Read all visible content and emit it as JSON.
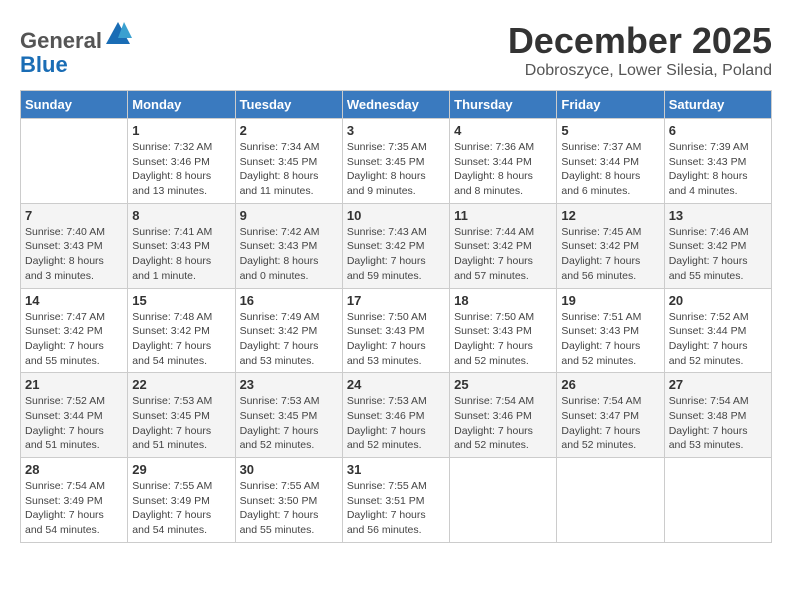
{
  "logo": {
    "general": "General",
    "blue": "Blue"
  },
  "header": {
    "month": "December 2025",
    "location": "Dobroszyce, Lower Silesia, Poland"
  },
  "weekdays": [
    "Sunday",
    "Monday",
    "Tuesday",
    "Wednesday",
    "Thursday",
    "Friday",
    "Saturday"
  ],
  "weeks": [
    [
      {
        "day": "",
        "info": ""
      },
      {
        "day": "1",
        "info": "Sunrise: 7:32 AM\nSunset: 3:46 PM\nDaylight: 8 hours\nand 13 minutes."
      },
      {
        "day": "2",
        "info": "Sunrise: 7:34 AM\nSunset: 3:45 PM\nDaylight: 8 hours\nand 11 minutes."
      },
      {
        "day": "3",
        "info": "Sunrise: 7:35 AM\nSunset: 3:45 PM\nDaylight: 8 hours\nand 9 minutes."
      },
      {
        "day": "4",
        "info": "Sunrise: 7:36 AM\nSunset: 3:44 PM\nDaylight: 8 hours\nand 8 minutes."
      },
      {
        "day": "5",
        "info": "Sunrise: 7:37 AM\nSunset: 3:44 PM\nDaylight: 8 hours\nand 6 minutes."
      },
      {
        "day": "6",
        "info": "Sunrise: 7:39 AM\nSunset: 3:43 PM\nDaylight: 8 hours\nand 4 minutes."
      }
    ],
    [
      {
        "day": "7",
        "info": "Sunrise: 7:40 AM\nSunset: 3:43 PM\nDaylight: 8 hours\nand 3 minutes."
      },
      {
        "day": "8",
        "info": "Sunrise: 7:41 AM\nSunset: 3:43 PM\nDaylight: 8 hours\nand 1 minute."
      },
      {
        "day": "9",
        "info": "Sunrise: 7:42 AM\nSunset: 3:43 PM\nDaylight: 8 hours\nand 0 minutes."
      },
      {
        "day": "10",
        "info": "Sunrise: 7:43 AM\nSunset: 3:42 PM\nDaylight: 7 hours\nand 59 minutes."
      },
      {
        "day": "11",
        "info": "Sunrise: 7:44 AM\nSunset: 3:42 PM\nDaylight: 7 hours\nand 57 minutes."
      },
      {
        "day": "12",
        "info": "Sunrise: 7:45 AM\nSunset: 3:42 PM\nDaylight: 7 hours\nand 56 minutes."
      },
      {
        "day": "13",
        "info": "Sunrise: 7:46 AM\nSunset: 3:42 PM\nDaylight: 7 hours\nand 55 minutes."
      }
    ],
    [
      {
        "day": "14",
        "info": "Sunrise: 7:47 AM\nSunset: 3:42 PM\nDaylight: 7 hours\nand 55 minutes."
      },
      {
        "day": "15",
        "info": "Sunrise: 7:48 AM\nSunset: 3:42 PM\nDaylight: 7 hours\nand 54 minutes."
      },
      {
        "day": "16",
        "info": "Sunrise: 7:49 AM\nSunset: 3:42 PM\nDaylight: 7 hours\nand 53 minutes."
      },
      {
        "day": "17",
        "info": "Sunrise: 7:50 AM\nSunset: 3:43 PM\nDaylight: 7 hours\nand 53 minutes."
      },
      {
        "day": "18",
        "info": "Sunrise: 7:50 AM\nSunset: 3:43 PM\nDaylight: 7 hours\nand 52 minutes."
      },
      {
        "day": "19",
        "info": "Sunrise: 7:51 AM\nSunset: 3:43 PM\nDaylight: 7 hours\nand 52 minutes."
      },
      {
        "day": "20",
        "info": "Sunrise: 7:52 AM\nSunset: 3:44 PM\nDaylight: 7 hours\nand 52 minutes."
      }
    ],
    [
      {
        "day": "21",
        "info": "Sunrise: 7:52 AM\nSunset: 3:44 PM\nDaylight: 7 hours\nand 51 minutes."
      },
      {
        "day": "22",
        "info": "Sunrise: 7:53 AM\nSunset: 3:45 PM\nDaylight: 7 hours\nand 51 minutes."
      },
      {
        "day": "23",
        "info": "Sunrise: 7:53 AM\nSunset: 3:45 PM\nDaylight: 7 hours\nand 52 minutes."
      },
      {
        "day": "24",
        "info": "Sunrise: 7:53 AM\nSunset: 3:46 PM\nDaylight: 7 hours\nand 52 minutes."
      },
      {
        "day": "25",
        "info": "Sunrise: 7:54 AM\nSunset: 3:46 PM\nDaylight: 7 hours\nand 52 minutes."
      },
      {
        "day": "26",
        "info": "Sunrise: 7:54 AM\nSunset: 3:47 PM\nDaylight: 7 hours\nand 52 minutes."
      },
      {
        "day": "27",
        "info": "Sunrise: 7:54 AM\nSunset: 3:48 PM\nDaylight: 7 hours\nand 53 minutes."
      }
    ],
    [
      {
        "day": "28",
        "info": "Sunrise: 7:54 AM\nSunset: 3:49 PM\nDaylight: 7 hours\nand 54 minutes."
      },
      {
        "day": "29",
        "info": "Sunrise: 7:55 AM\nSunset: 3:49 PM\nDaylight: 7 hours\nand 54 minutes."
      },
      {
        "day": "30",
        "info": "Sunrise: 7:55 AM\nSunset: 3:50 PM\nDaylight: 7 hours\nand 55 minutes."
      },
      {
        "day": "31",
        "info": "Sunrise: 7:55 AM\nSunset: 3:51 PM\nDaylight: 7 hours\nand 56 minutes."
      },
      {
        "day": "",
        "info": ""
      },
      {
        "day": "",
        "info": ""
      },
      {
        "day": "",
        "info": ""
      }
    ]
  ]
}
